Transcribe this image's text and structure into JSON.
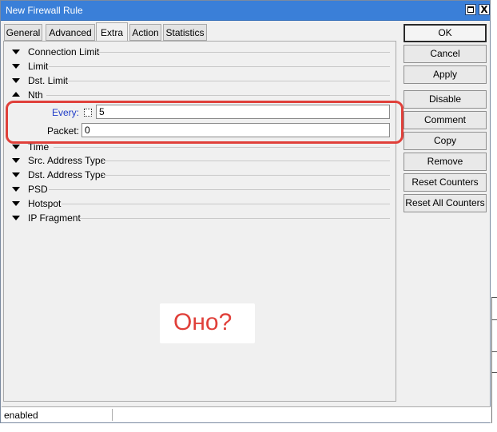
{
  "window": {
    "title": "New Firewall Rule",
    "maximize_label": "",
    "close_label": "X"
  },
  "tabs": [
    "General",
    "Advanced",
    "Extra",
    "Action",
    "Statistics"
  ],
  "active_tab": "Extra",
  "sections": [
    {
      "label": "Connection Limit",
      "expanded": false
    },
    {
      "label": "Limit",
      "expanded": false
    },
    {
      "label": "Dst. Limit",
      "expanded": false
    },
    {
      "label": "Nth",
      "expanded": true
    },
    {
      "label": "Time",
      "expanded": false
    },
    {
      "label": "Src. Address Type",
      "expanded": false
    },
    {
      "label": "Dst. Address Type",
      "expanded": false
    },
    {
      "label": "PSD",
      "expanded": false
    },
    {
      "label": "Hotspot",
      "expanded": false
    },
    {
      "label": "IP Fragment",
      "expanded": false
    }
  ],
  "nth": {
    "every_label": "Every:",
    "every_value": "5",
    "packet_label": "Packet:",
    "packet_value": "0"
  },
  "buttons": [
    "OK",
    "Cancel",
    "Apply",
    "Disable",
    "Comment",
    "Copy",
    "Remove",
    "Reset Counters",
    "Reset All Counters"
  ],
  "status": {
    "text": "enabled"
  },
  "annotation": {
    "text": "Оно?"
  },
  "colors": {
    "title_bar": "#3a7fd8",
    "highlight": "#e0403a",
    "label_blue": "#1f3cc8"
  }
}
